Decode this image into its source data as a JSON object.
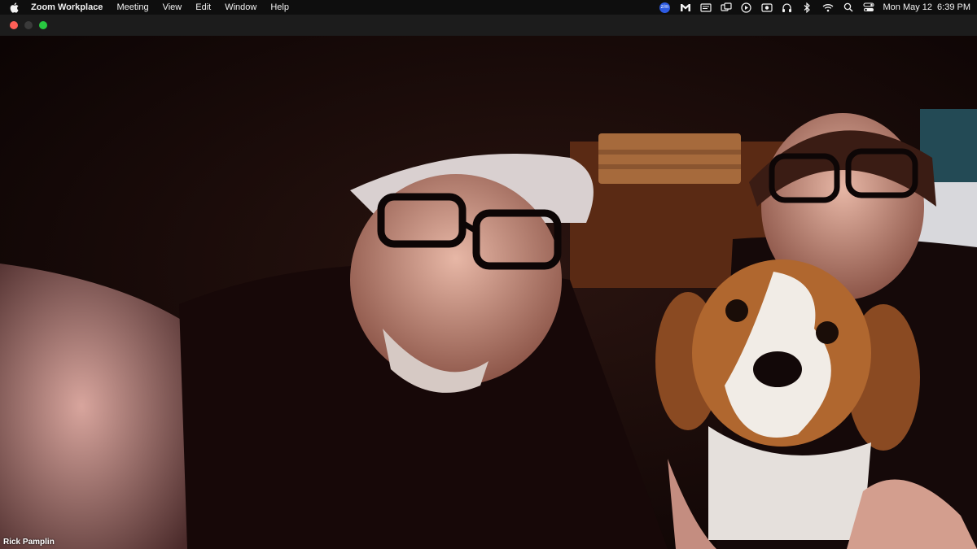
{
  "menubar": {
    "app_name": "Zoom Workplace",
    "items": [
      "Meeting",
      "View",
      "Edit",
      "Window",
      "Help"
    ],
    "zoom_badge": "z/m",
    "date": "Mon May 12",
    "time": "6:39 PM"
  },
  "video": {
    "participant_name": "Rick Pamplin"
  },
  "colors": {
    "close": "#ff5f57",
    "minimize": "#3a3a3a",
    "zoom": "#28c840"
  }
}
